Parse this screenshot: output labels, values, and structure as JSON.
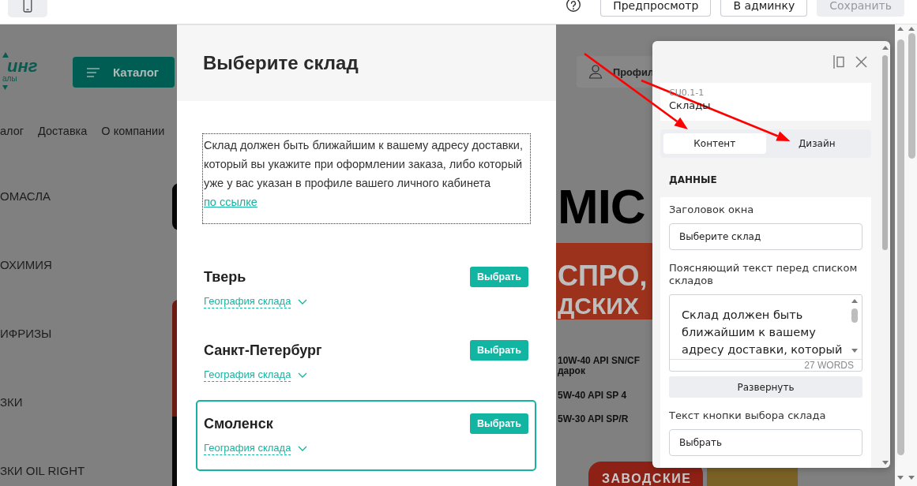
{
  "toolbar": {
    "device_toggle": {
      "selected": true
    },
    "buttons": [
      {
        "label": "Предпросмотр",
        "disabled": false
      },
      {
        "label": "В админку",
        "disabled": false
      },
      {
        "label": "Сохранить",
        "disabled": true
      }
    ]
  },
  "site": {
    "logo": {
      "text": "инг",
      "tagline": "алы"
    },
    "catalog_button": "Каталог",
    "profile_button": "Профил",
    "nav": [
      "алог",
      "Доставка",
      "О компании"
    ],
    "categories": [
      "ОМАСЛА",
      "ОХИМИЯ",
      "ИФРИЗЫ",
      "ЗКИ",
      "ЗКИ OIL RIGHT"
    ],
    "banner": {
      "brand": "MIC",
      "headline": [
        "СПРО,",
        "ДСКИХ"
      ],
      "products": [
        {
          "text": "10W-40 API SN/CF",
          "note": "дарок"
        },
        {
          "text": "5W-40 API SP 4"
        },
        {
          "text": "5W-30 API SP/R"
        }
      ],
      "label": "ЗАВОДСКИЕ"
    }
  },
  "modal": {
    "title": "Выберите склад",
    "description": {
      "text": "Склад должен быть ближайшим к вашему адресу доставки, который вы укажите при оформлении заказа, либо который уже у вас указан в профиле вашего личного кабинета",
      "link": "по ссылке"
    },
    "warehouses": [
      {
        "name": "Тверь",
        "button": "Выбрать",
        "geo_link": "География склада",
        "expanded": false,
        "selected": false
      },
      {
        "name": "Санкт-Петербург",
        "button": "Выбрать",
        "geo_link": "География склада",
        "expanded": false,
        "selected": false
      },
      {
        "name": "Смоленск",
        "button": "Выбрать",
        "geo_link": "География склада",
        "expanded": false,
        "selected": true
      }
    ]
  },
  "panel": {
    "block_id": "CU0.1-1",
    "block_name": "Склады",
    "tabs": [
      {
        "label": "Контент",
        "selected": true
      },
      {
        "label": "Дизайн",
        "selected": false
      }
    ],
    "section": "ДАННЫЕ",
    "fields": [
      {
        "kind": "input",
        "label": "Заголовок окна",
        "value": "Выберите склад"
      },
      {
        "kind": "editor",
        "label": "Поясняющий текст перед списком складов",
        "value": "Склад должен быть ближайшим к вашему адресу доставки, который",
        "word_count": "27 WORDS",
        "button": "Развернуть"
      },
      {
        "kind": "input",
        "label": "Текст кнопки выбора склада",
        "value": "Выбрать"
      }
    ]
  },
  "annotations": [
    {
      "kind": "arrow"
    },
    {
      "kind": "arrow"
    }
  ]
}
